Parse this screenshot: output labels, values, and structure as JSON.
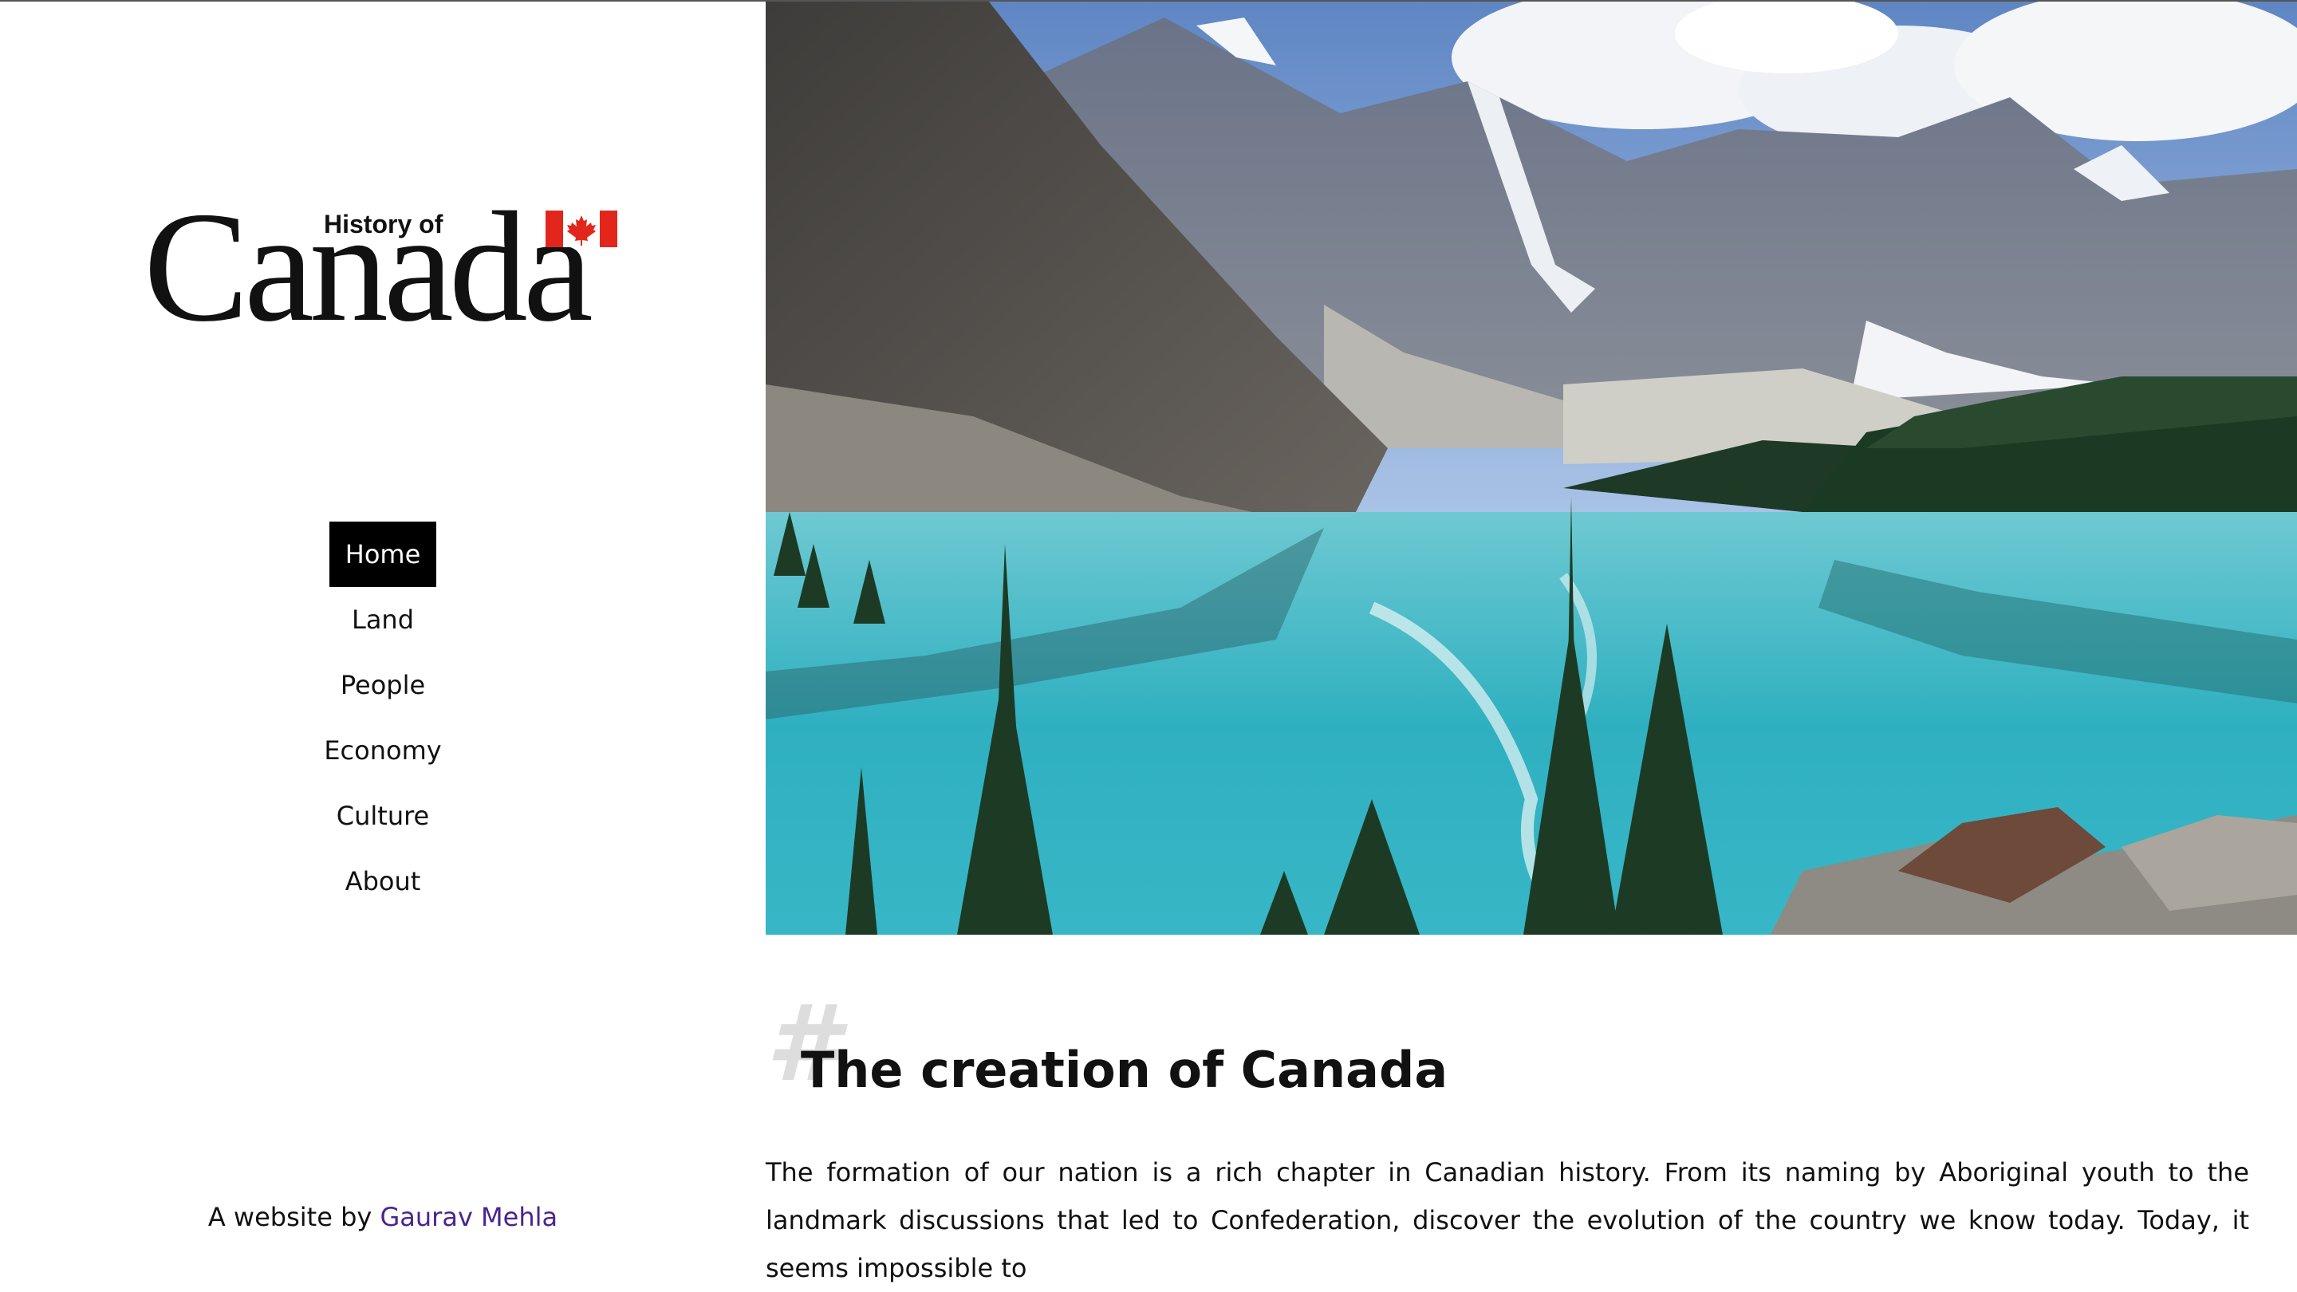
{
  "logo": {
    "small_text": "History of",
    "large_text": "Canada",
    "flag_colors": {
      "red": "#e3261c",
      "white": "#ffffff"
    }
  },
  "nav": {
    "items": [
      {
        "label": "Home",
        "active": true
      },
      {
        "label": "Land",
        "active": false
      },
      {
        "label": "People",
        "active": false
      },
      {
        "label": "Economy",
        "active": false
      },
      {
        "label": "Culture",
        "active": false
      },
      {
        "label": "About",
        "active": false
      }
    ]
  },
  "footer": {
    "prefix": "A website by ",
    "author": "Gaurav Mehla",
    "author_color": "#4a2490"
  },
  "hero": {
    "image_icon": "mountain-lake-photo-icon"
  },
  "article": {
    "hash_symbol": "#",
    "title": "The creation of Canada",
    "intro": "The formation of our nation is a rich chapter in Canadian history. From its naming by Aboriginal youth to the landmark discussions that led to Confederation, discover the evolution of the country we know today. Today, it seems impossible to"
  },
  "colors": {
    "nav_active_bg": "#000000",
    "nav_active_text": "#ffffff",
    "lake": "#3fb8c4",
    "forest": "#1f3f2a"
  }
}
